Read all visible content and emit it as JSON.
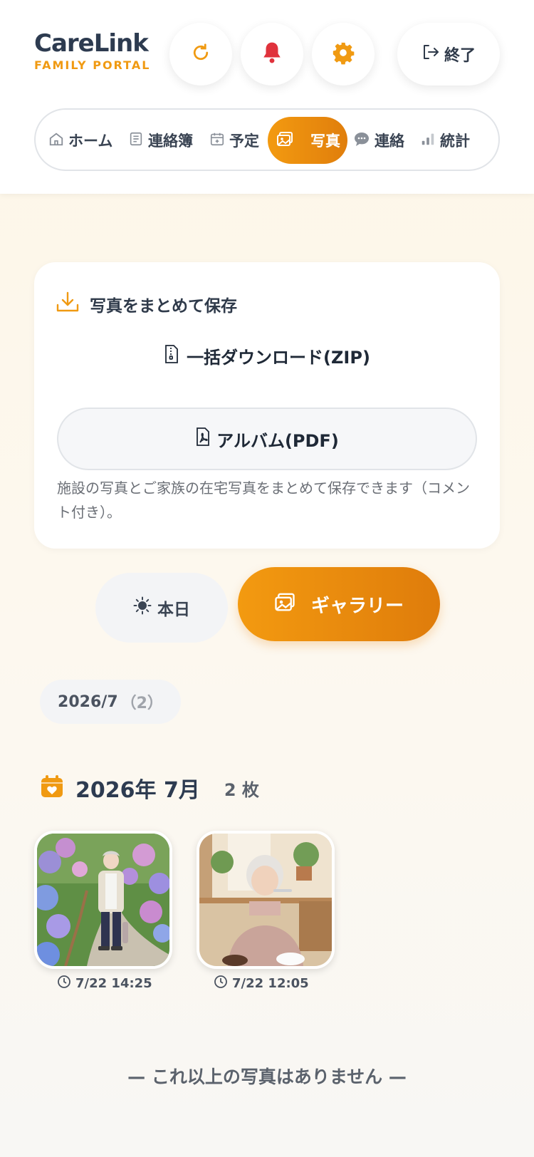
{
  "app": {
    "name": "CareLink",
    "subtitle": "FAMILY PORTAL"
  },
  "header": {
    "exit_label": "終了"
  },
  "nav": {
    "items": [
      {
        "label": "ホーム",
        "icon": "home-icon"
      },
      {
        "label": "連絡簿",
        "icon": "notebook-icon"
      },
      {
        "label": "予定",
        "icon": "calendar-icon"
      },
      {
        "label": "写真",
        "icon": "photo-icon",
        "active": true
      },
      {
        "label": "連絡",
        "icon": "chat-icon"
      },
      {
        "label": "統計",
        "icon": "chart-icon"
      }
    ]
  },
  "save_card": {
    "title": "写真をまとめて保存",
    "zip_label": "一括ダウンロード(ZIP)",
    "pdf_label": "アルバム(PDF)",
    "description": "施設の写真とご家族の在宅写真をまとめて保存できます（コメント付き）。"
  },
  "view_toggle": {
    "today_label": "本日",
    "gallery_label": "ギャラリー",
    "active": "gallery"
  },
  "month_filter": {
    "label": "2026/7",
    "count": "（2）"
  },
  "month_section": {
    "title": "2026年 7月",
    "count": "2 枚",
    "photos": [
      {
        "time": "7/22 14:25",
        "subject": "walking-on-garden-path"
      },
      {
        "time": "7/22 12:05",
        "subject": "eating-meal"
      }
    ]
  },
  "end_message": "— これ以上の写真はありません —",
  "colors": {
    "accent": "#f09a12",
    "bell": "#e0323c",
    "text": "#2f3a4a"
  }
}
